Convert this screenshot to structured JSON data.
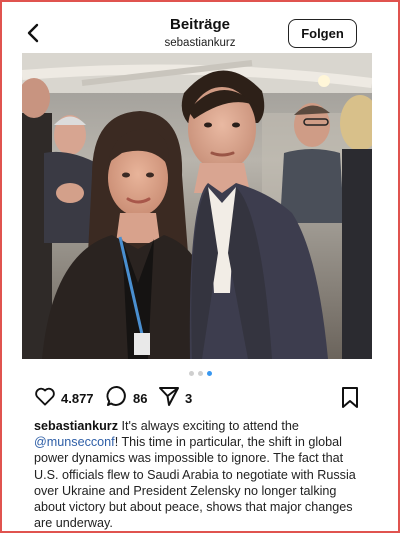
{
  "header": {
    "title": "Beiträge",
    "username": "sebastiankurz",
    "follow_label": "Folgen"
  },
  "icons": {
    "back": "chevron-left-icon",
    "like": "heart-icon",
    "comment": "comment-bubble-icon",
    "share": "paper-plane-icon",
    "save": "bookmark-icon"
  },
  "post": {
    "carousel": {
      "total": 3,
      "active_index": 2
    },
    "likes": "4.877",
    "comments": "86",
    "shares": "3"
  },
  "caption": {
    "user": "sebastiankurz",
    "lead": " It's always exciting to attend the ",
    "mention": "@munsecconf",
    "body": "! This time in particular, the shift in global power dynamics was impossible to ignore. The fact that U.S. officials flew to Saudi Arabia to negotiate with Russia over Ukraine and President Zelensky no longer talking about victory but about peace, shows that major changes are underway."
  },
  "colors": {
    "frame": "#e0534f",
    "mention": "#2f5fa7",
    "active_dot": "#3897f0"
  }
}
